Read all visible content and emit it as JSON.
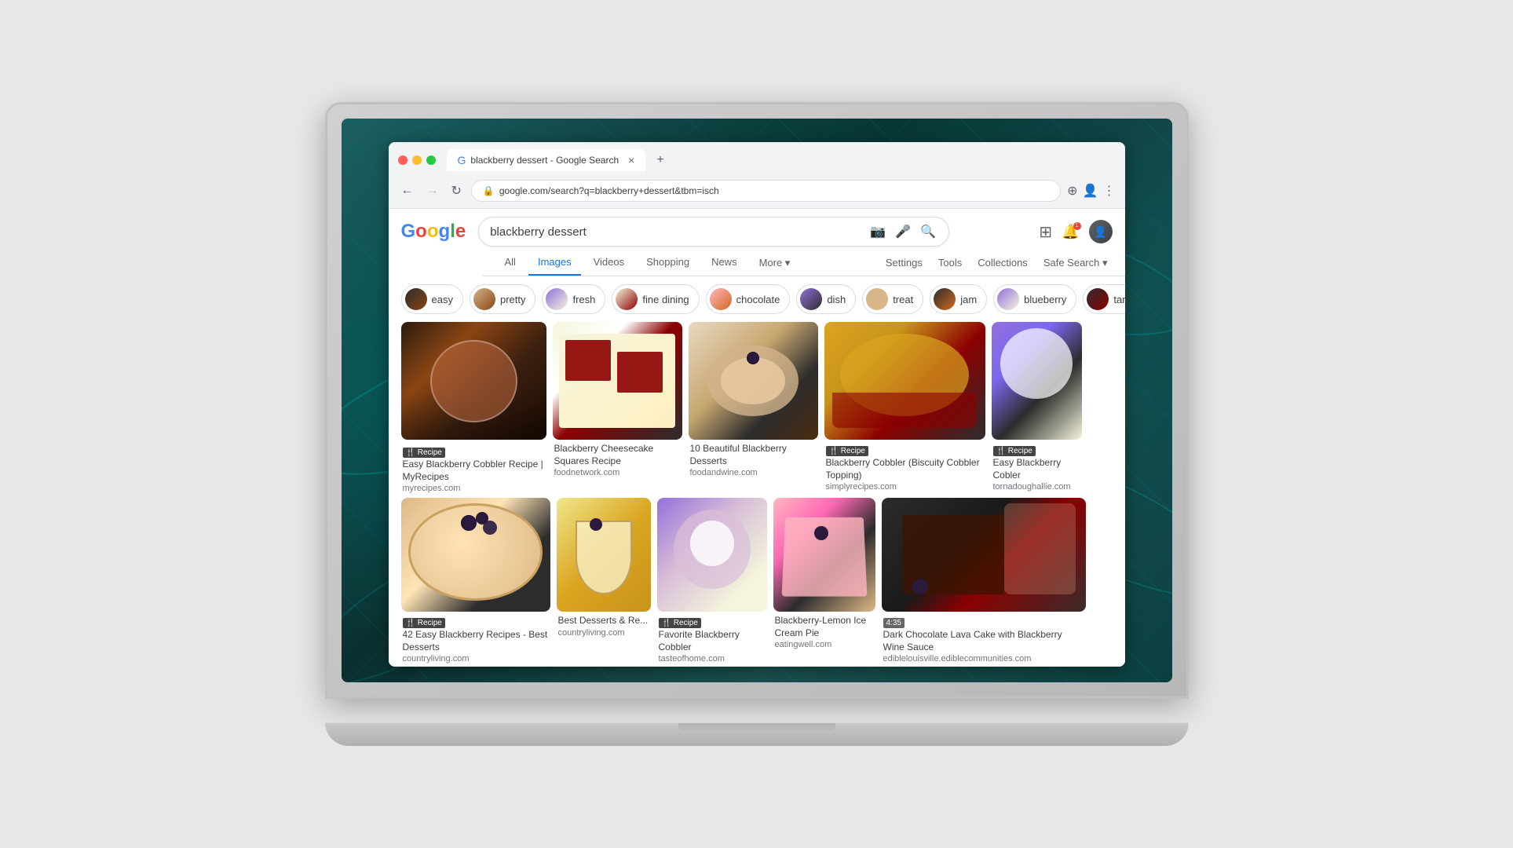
{
  "laptop": {
    "bg": "tropical teal leaf background"
  },
  "browser": {
    "tab_title": "blackberry dessert - Google Search",
    "address": "google.com/search?q=blackberry+dessert&tbm=isch"
  },
  "google": {
    "logo": "Google",
    "search_query": "blackberry dessert",
    "nav_tabs": [
      "All",
      "Images",
      "Videos",
      "Shopping",
      "News",
      "More",
      "Settings",
      "Tools"
    ],
    "active_tab": "Images",
    "collections_label": "Collections",
    "safe_search_label": "Safe Search",
    "filter_chips": [
      {
        "label": "easy",
        "color_class": "chip-easy"
      },
      {
        "label": "pretty",
        "color_class": "chip-pretty"
      },
      {
        "label": "fresh",
        "color_class": "chip-fresh"
      },
      {
        "label": "fine dining",
        "color_class": "chip-finedining"
      },
      {
        "label": "chocolate",
        "color_class": "chip-chocolate"
      },
      {
        "label": "dish",
        "color_class": "chip-dish"
      },
      {
        "label": "treat",
        "color_class": "chip-treat"
      },
      {
        "label": "jam",
        "color_class": "chip-jam"
      },
      {
        "label": "blueberry",
        "color_class": "chip-blueberry"
      },
      {
        "label": "tart",
        "color_class": "chip-tart"
      }
    ],
    "images_row1": [
      {
        "title": "Easy Blackberry Cobbler Recipe | MyRecipes",
        "source": "myrecipes.com",
        "has_recipe": true,
        "color_class": "food-cobbler"
      },
      {
        "title": "Blackberry Cheesecake Squares Recipe",
        "source": "foodnetwork.com",
        "has_recipe": false,
        "color_class": "food-cheesecake"
      },
      {
        "title": "10 Beautiful Blackberry Desserts",
        "source": "foodandwine.com",
        "has_recipe": false,
        "color_class": "food-pancakes"
      },
      {
        "title": "Blackberry Cobbler (Biscuity Cobbler Topping)",
        "source": "simplyrecipes.com",
        "has_recipe": true,
        "color_class": "food-biscuit"
      },
      {
        "title": "Easy Blackberry Cobler",
        "source": "tornadoughallie.com",
        "has_recipe": true,
        "color_class": "food-cobbler2"
      }
    ],
    "images_row2": [
      {
        "title": "42 Easy Blackberry Recipes - Best Desserts",
        "source": "countryliving.com",
        "has_recipe": true,
        "color_class": "food-cheesecake2"
      },
      {
        "title": "Best Desserts & Re...",
        "source": "countryliving.com",
        "has_recipe": false,
        "color_class": "food-dessert"
      },
      {
        "title": "Favorite Blackberry Cobbler",
        "source": "tasteofhome.com",
        "has_recipe": true,
        "color_class": "food-cobbler3"
      },
      {
        "title": "Blackberry-Lemon Ice Cream Pie",
        "source": "eatingwell.com",
        "has_recipe": false,
        "color_class": "food-pie"
      },
      {
        "title": "Dark Chocolate Lava Cake with Blackberry Wine Sauce",
        "source": "ediblelouisville.ediblecommunities.com",
        "has_recipe": false,
        "time": "4:35",
        "color_class": "food-lava"
      }
    ],
    "images_row3": [
      {
        "title": "",
        "source": "",
        "color_class": "food-bottom1"
      },
      {
        "title": "",
        "source": "",
        "color_class": "food-bottom2"
      },
      {
        "title": "",
        "source": "",
        "color_class": "food-bottom3"
      },
      {
        "title": "",
        "source": "",
        "color_class": "food-bottom4"
      },
      {
        "title": "",
        "source": "",
        "color_class": "food-bottom5"
      },
      {
        "title": "",
        "source": "",
        "color_class": "food-bottom6"
      }
    ]
  }
}
